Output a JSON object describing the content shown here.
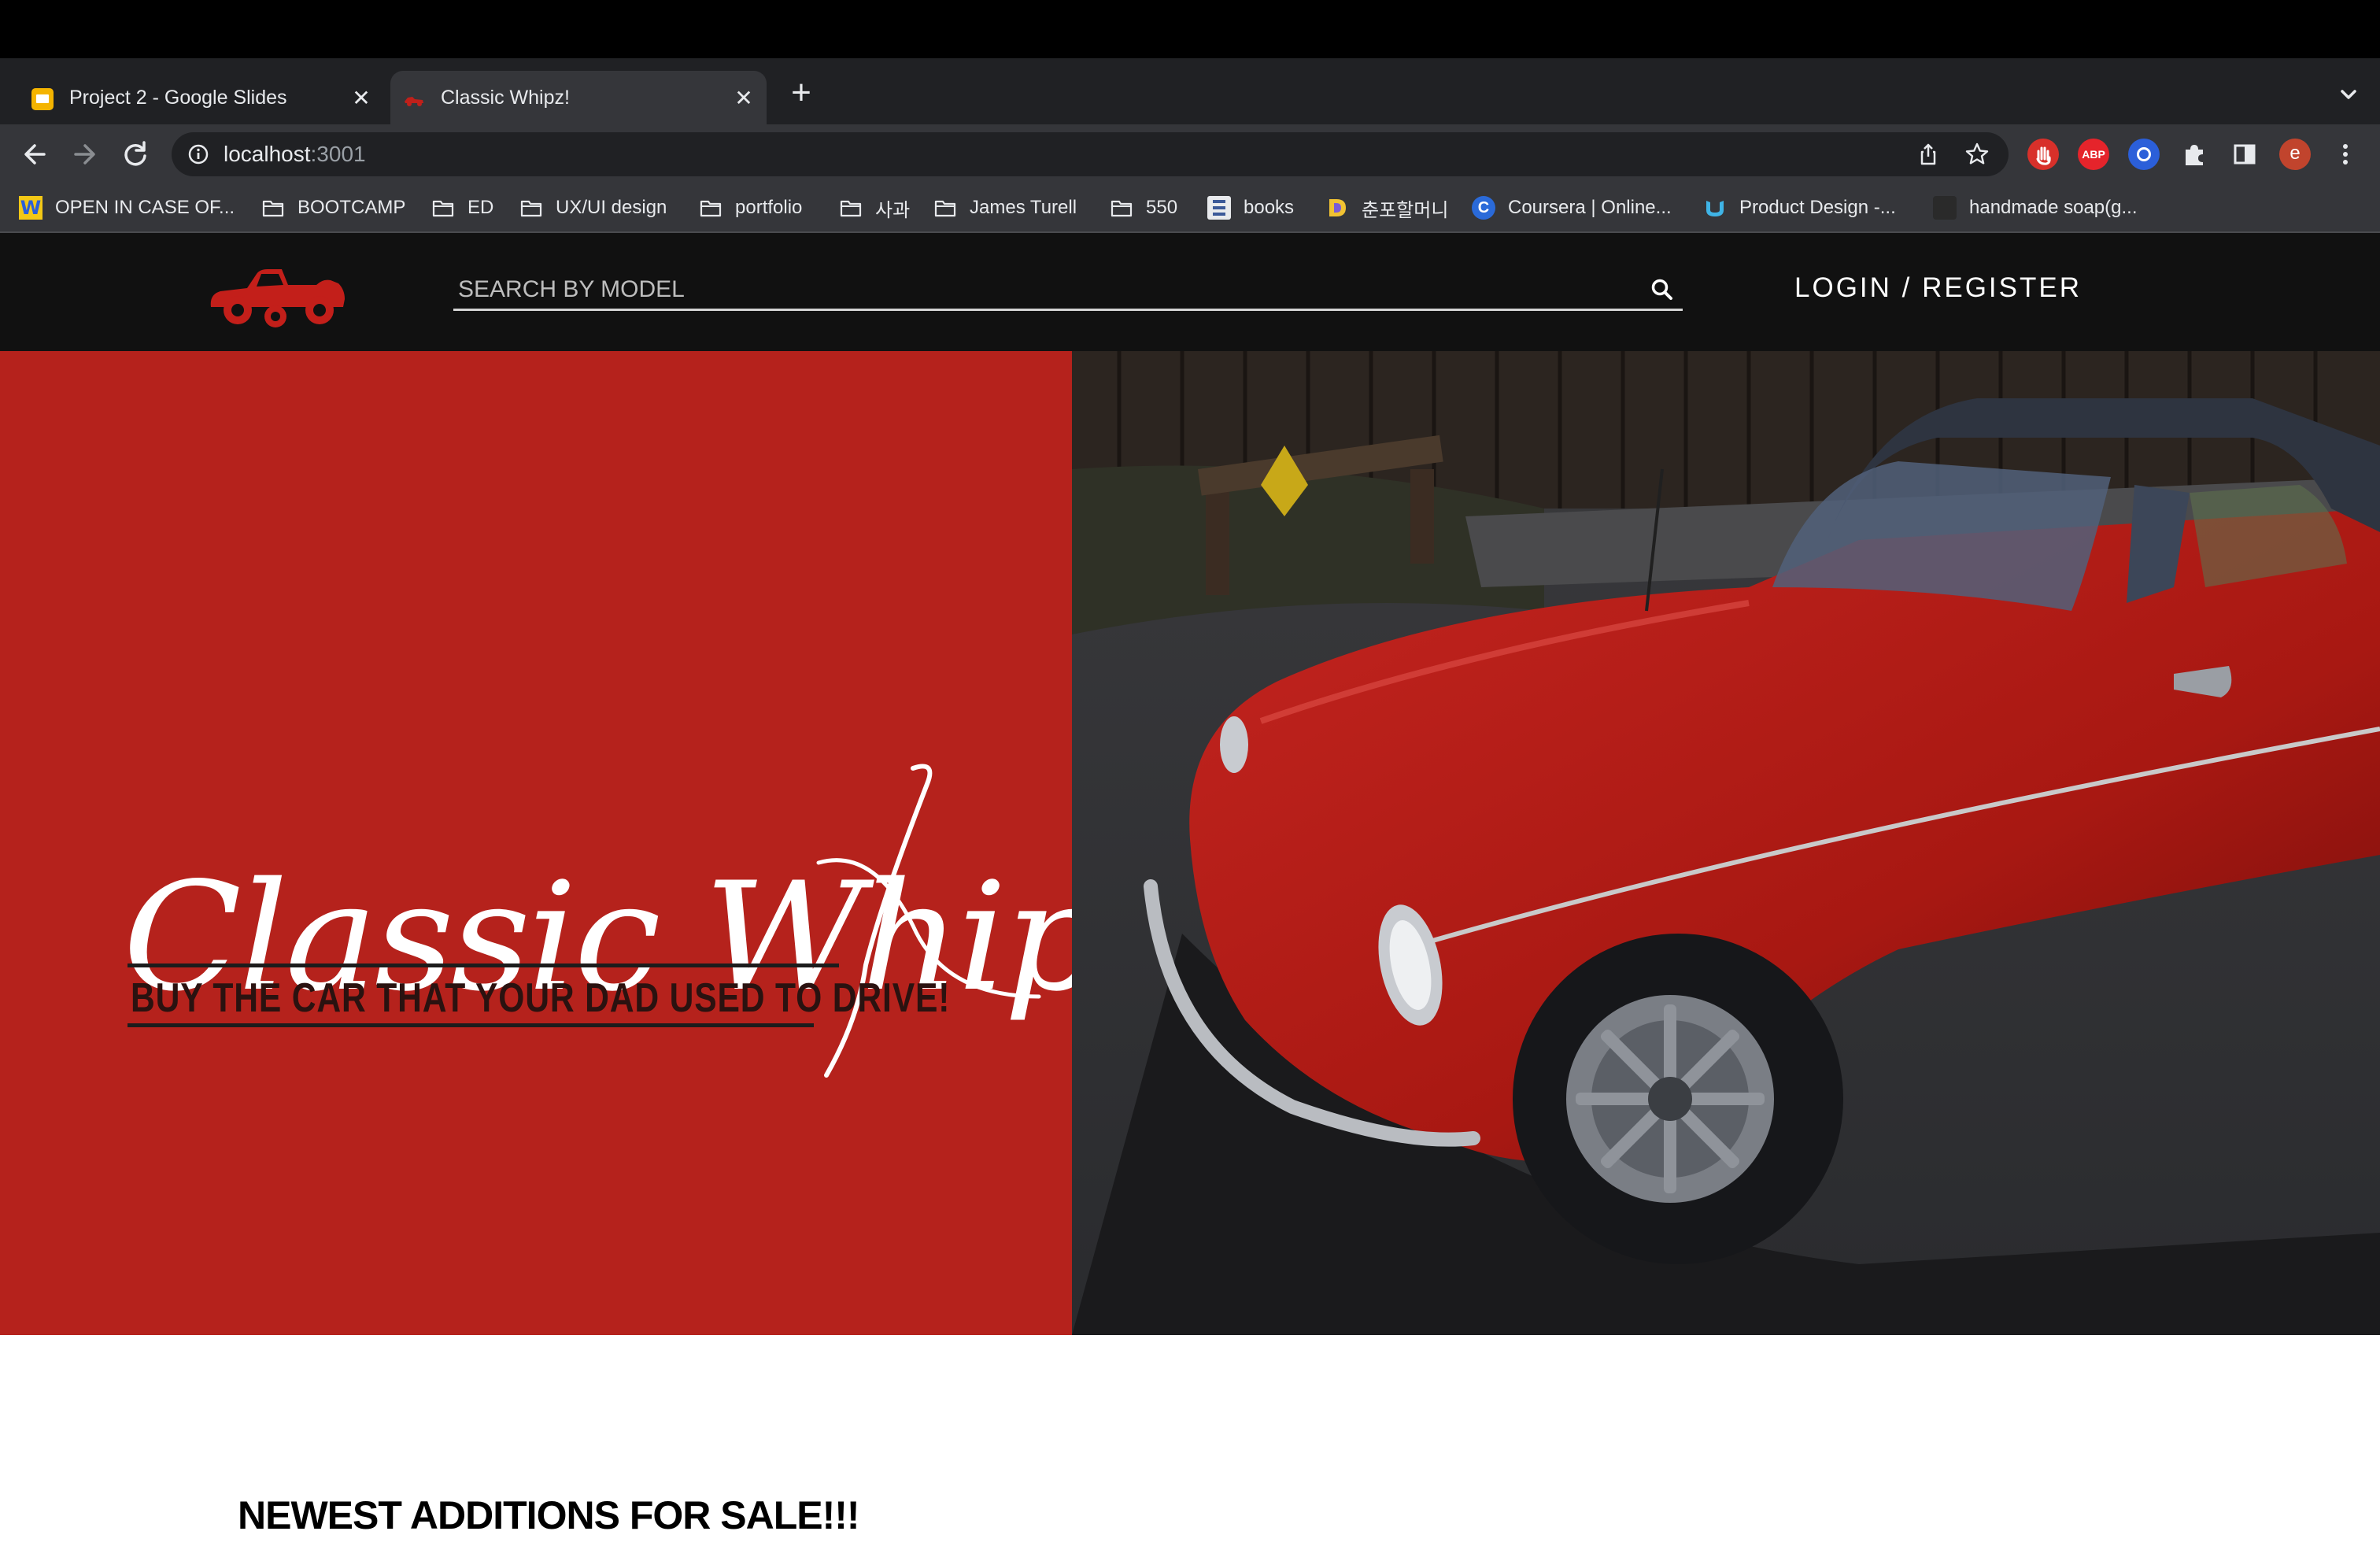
{
  "browser": {
    "tabs": [
      {
        "title": "Project 2 - Google Slides",
        "active": false,
        "favicon": "google-slides-icon"
      },
      {
        "title": "Classic Whipz!",
        "active": true,
        "favicon": "red-car-icon"
      }
    ],
    "url_host": "localhost",
    "url_port": ":3001",
    "profile_initial": "e",
    "extensions": [
      "red-hand-extension-icon",
      "adblock-plus-icon",
      "blue-ring-extension-icon",
      "puzzle-extensions-icon",
      "side-panel-icon"
    ],
    "abp_label": "ABP",
    "colors": {
      "frame": "#202124",
      "toolbar": "#35363a",
      "text": "#e8eaed",
      "profile": "#c1442d"
    }
  },
  "bookmarks": [
    {
      "label": "OPEN IN CASE OF...",
      "icon": "yellow-w-icon"
    },
    {
      "label": "BOOTCAMP",
      "icon": "folder-icon"
    },
    {
      "label": "ED",
      "icon": "folder-icon"
    },
    {
      "label": "UX/UI design",
      "icon": "folder-icon"
    },
    {
      "label": "portfolio",
      "icon": "folder-icon"
    },
    {
      "label": "사과",
      "icon": "folder-icon"
    },
    {
      "label": "James Turell",
      "icon": "folder-icon"
    },
    {
      "label": "550",
      "icon": "folder-icon"
    },
    {
      "label": "books",
      "icon": "book-icon"
    },
    {
      "label": "춘포할머니",
      "icon": "d-logo-icon"
    },
    {
      "label": "Coursera | Online...",
      "icon": "coursera-icon"
    },
    {
      "label": "Product Design -...",
      "icon": "udacity-icon"
    },
    {
      "label": "handmade soap(g...",
      "icon": "dark-site-icon"
    }
  ],
  "site": {
    "search_placeholder": "SEARCH BY MODEL",
    "login_label": "LOGIN / REGISTER",
    "brand_script": "Classic Whipz",
    "tagline": "BUY THE CAR THAT YOUR DAD USED TO DRIVE!",
    "section_heading": "NEWEST ADDITIONS FOR SALE!!!",
    "colors": {
      "header": "#111111",
      "hero_red": "#b5221c",
      "car_red": "#b81d18"
    }
  }
}
